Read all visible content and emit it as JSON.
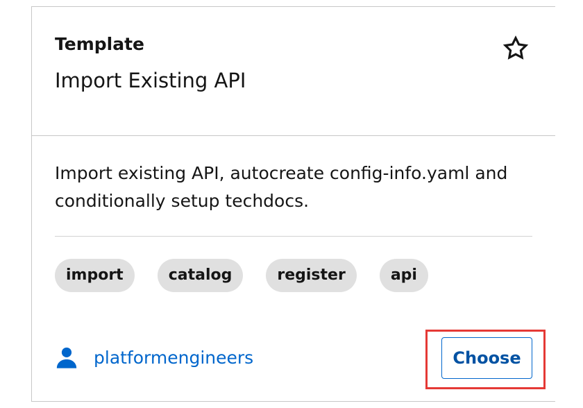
{
  "card": {
    "eyebrow": "Template",
    "title": "Import Existing API",
    "description": "Import existing API, autocreate config-info.yaml and conditionally setup techdocs.",
    "tags": [
      "import",
      "catalog",
      "register",
      "api"
    ],
    "owner": "platformengineers",
    "choose_label": "Choose"
  },
  "icons": {
    "favorite": "star-outline-icon",
    "owner": "user-icon"
  },
  "colors": {
    "link": "#0066cc",
    "tag_bg": "#e0e0e0",
    "highlight": "#e53935"
  }
}
